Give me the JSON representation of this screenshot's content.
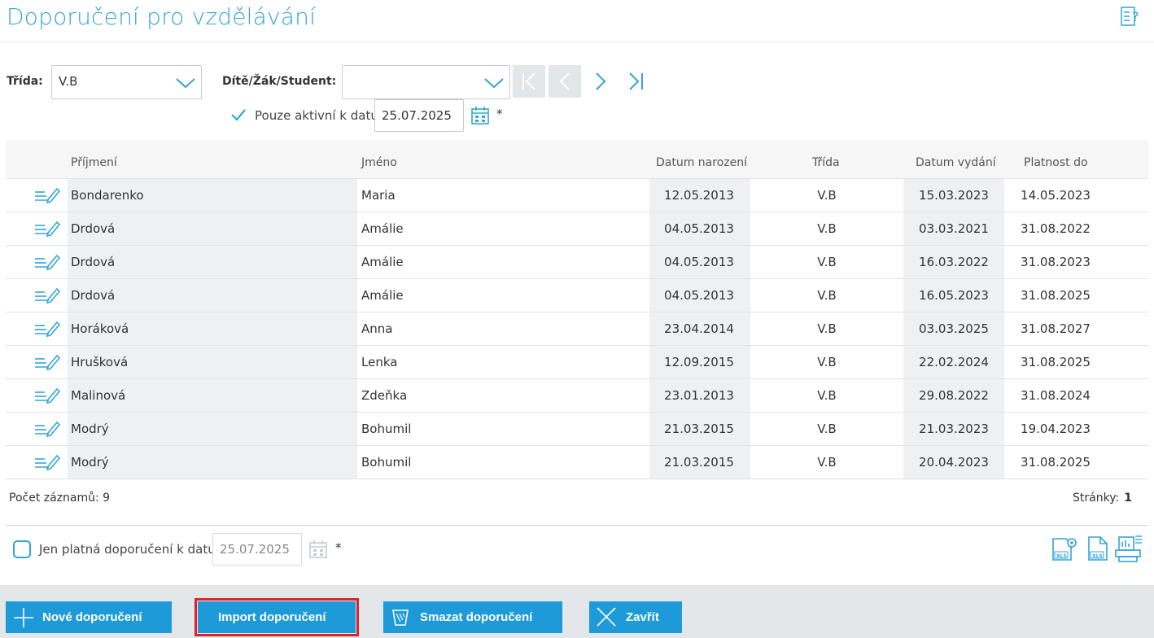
{
  "page": {
    "title": "Doporučení pro vzdělávání"
  },
  "filters": {
    "class_label": "Třída:",
    "class_value": "V.B",
    "student_label": "Dítě/Žák/Student:",
    "student_value": "",
    "active_label": "Pouze aktivní k datu",
    "active_checked": true,
    "active_date": "25.07.2025",
    "asterisk": "*"
  },
  "table": {
    "columns": [
      "Příjmení",
      "Jméno",
      "Datum narození",
      "Třída",
      "Datum vydání",
      "Platnost do"
    ],
    "rows": [
      [
        "Bondarenko",
        "Maria",
        "12.05.2013",
        "V.B",
        "15.03.2023",
        "14.05.2023"
      ],
      [
        "Drdová",
        "Amálie",
        "04.05.2013",
        "V.B",
        "03.03.2021",
        "31.08.2022"
      ],
      [
        "Drdová",
        "Amálie",
        "04.05.2013",
        "V.B",
        "16.03.2022",
        "31.08.2023"
      ],
      [
        "Drdová",
        "Amálie",
        "04.05.2013",
        "V.B",
        "16.05.2023",
        "31.08.2025"
      ],
      [
        "Horáková",
        "Anna",
        "23.04.2014",
        "V.B",
        "03.03.2025",
        "31.08.2027"
      ],
      [
        "Hrušková",
        "Lenka",
        "12.09.2015",
        "V.B",
        "22.02.2024",
        "31.08.2025"
      ],
      [
        "Malinová",
        "Zdeňka",
        "23.01.2013",
        "V.B",
        "29.08.2022",
        "31.08.2024"
      ],
      [
        "Modrý",
        "Bohumil",
        "21.03.2015",
        "V.B",
        "21.03.2023",
        "19.04.2023"
      ],
      [
        "Modrý",
        "Bohumil",
        "21.03.2015",
        "V.B",
        "20.04.2023",
        "31.08.2025"
      ]
    ]
  },
  "summary": {
    "count_label": "Počet záznamů: 9",
    "pages_label": "Stránky:",
    "pages_value": "1"
  },
  "valid_filter": {
    "label": "Jen platná doporučení k datu",
    "checked": false,
    "date": "25.07.2025",
    "asterisk": "*"
  },
  "buttons": {
    "new": "Nové doporučení",
    "import": "Import doporučení",
    "delete": "Smazat doporučení",
    "close": "Zavřít"
  },
  "colors": {
    "accent": "#33a5d6",
    "button": "#1e9ad9",
    "highlight": "#e0202a"
  }
}
